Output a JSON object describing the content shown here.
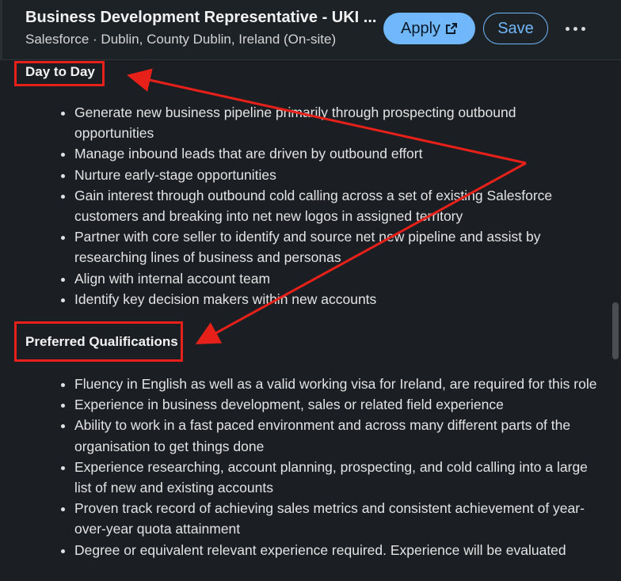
{
  "header": {
    "title": "Business Development Representative - UKI ...",
    "subtitle": "Salesforce · Dublin, County Dublin, Ireland (On-site)",
    "apply_label": "Apply",
    "save_label": "Save"
  },
  "sections": {
    "day_to_day": {
      "heading": "Day to Day",
      "items": [
        "Generate new business pipeline primarily through prospecting outbound opportunities",
        "Manage inbound leads that are driven by outbound effort",
        "Nurture early-stage opportunities",
        "Gain interest through outbound cold calling across a set of existing Salesforce customers and breaking into net new logos in assigned territory",
        "Partner with core seller to identify and source net new pipeline and assist by researching lines of business and personas",
        "Align with internal account team",
        "Identify key decision makers within new accounts"
      ]
    },
    "preferred": {
      "heading": "Preferred Qualifications",
      "items": [
        "Fluency in English as well as a valid working visa for Ireland, are required for this role",
        "Experience in business development, sales or related field experience",
        "Ability to work in a fast paced environment and across many different parts of the organisation to get things done",
        "Experience researching, account planning, prospecting, and cold calling into a large list of new and existing accounts",
        "Proven track record of achieving sales metrics and consistent achievement of year-over-year quota attainment",
        "Degree or equivalent relevant experience required. Experience will be evaluated"
      ]
    }
  },
  "colors": {
    "accent": "#71b7fb",
    "annotation": "#e8201a",
    "background": "#1b1f23"
  }
}
